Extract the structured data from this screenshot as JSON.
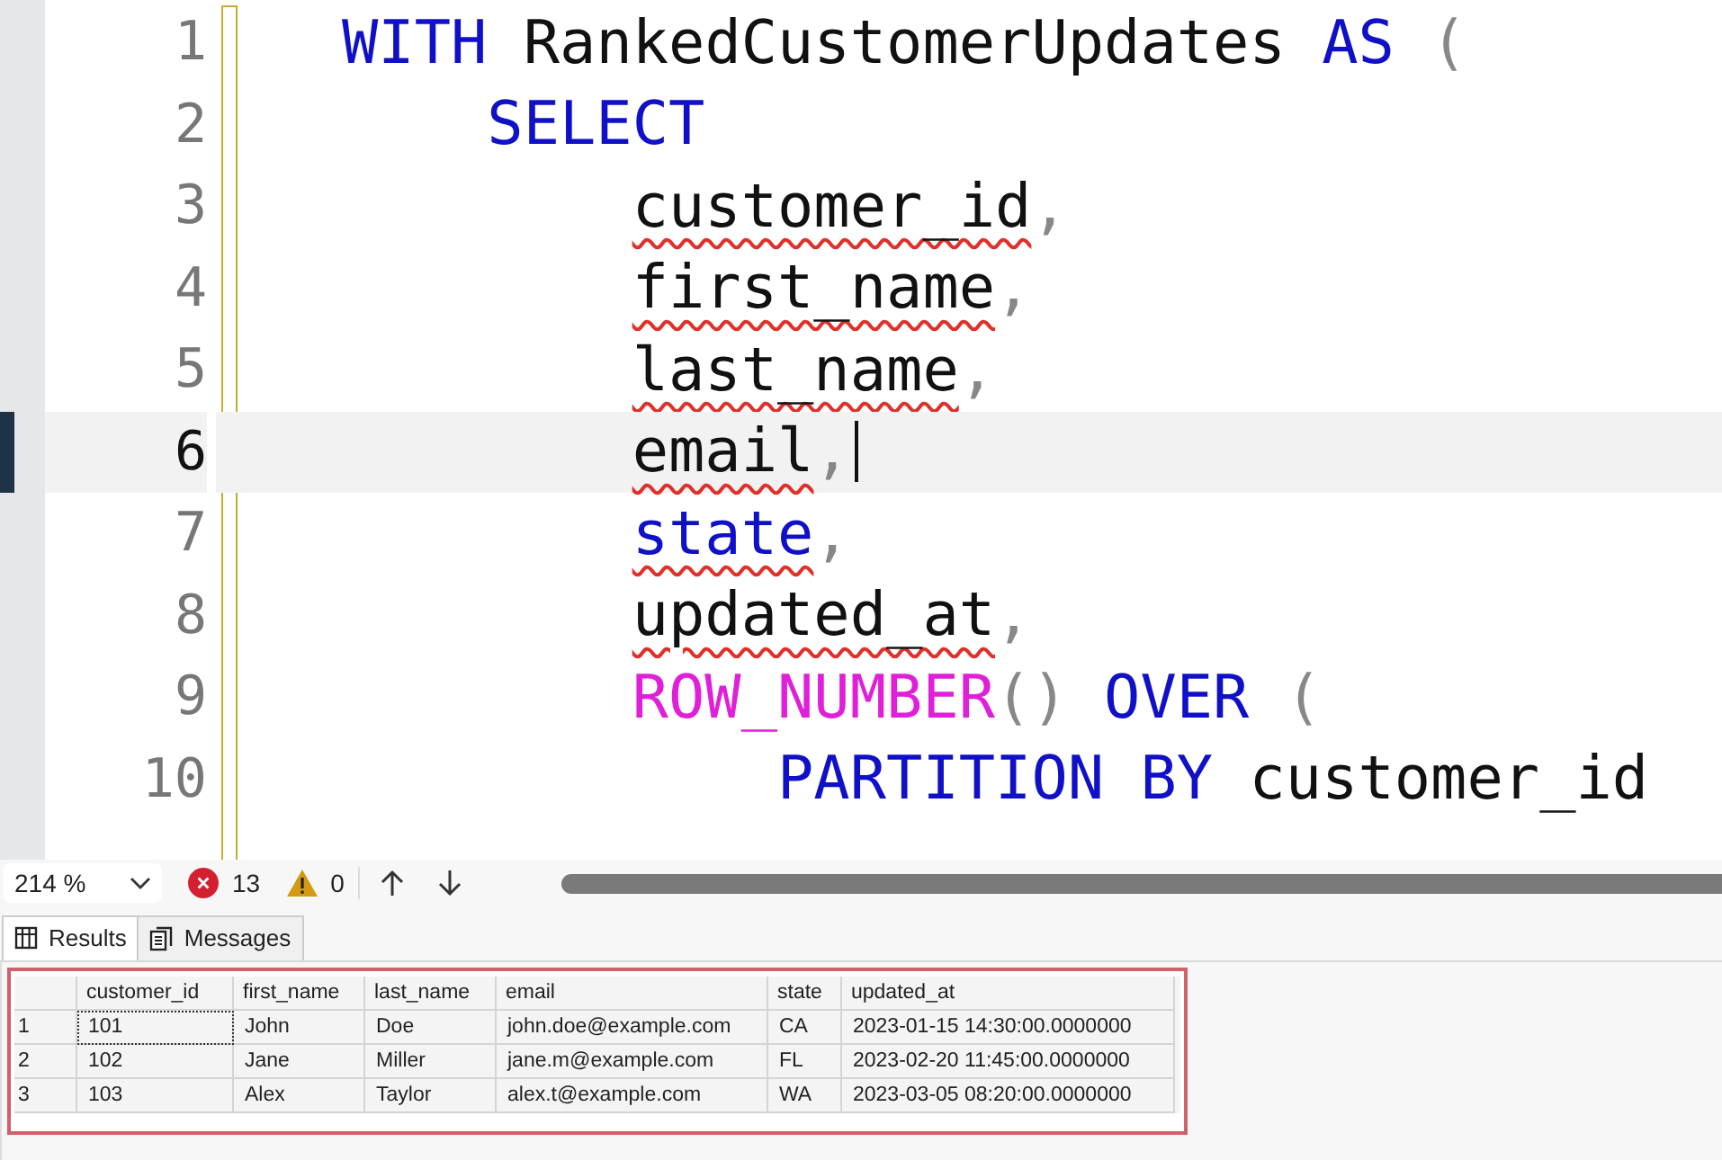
{
  "editor": {
    "lines": [
      {
        "number": "1",
        "current": false,
        "tokens": [
          {
            "text": "WITH",
            "kind": "keyword",
            "error": false
          },
          {
            "text": " RankedCustomerUpdates ",
            "kind": "ident",
            "error": false
          },
          {
            "text": "AS",
            "kind": "keyword",
            "error": false
          },
          {
            "text": " (",
            "kind": "punct",
            "error": false
          }
        ],
        "children": [
          {
            "number": "2",
            "current": false,
            "tokens": [
              {
                "text": "SELECT",
                "kind": "keyword",
                "error": false
              }
            ],
            "children": [
              {
                "number": "3",
                "current": false,
                "tokens": [
                  {
                    "text": "customer_id",
                    "kind": "ident",
                    "error": true
                  },
                  {
                    "text": ",",
                    "kind": "punct",
                    "error": false
                  }
                ]
              },
              {
                "number": "4",
                "current": false,
                "tokens": [
                  {
                    "text": "first_name",
                    "kind": "ident",
                    "error": true
                  },
                  {
                    "text": ",",
                    "kind": "punct",
                    "error": false
                  }
                ]
              },
              {
                "number": "5",
                "current": false,
                "tokens": [
                  {
                    "text": "last_name",
                    "kind": "ident",
                    "error": true
                  },
                  {
                    "text": ",",
                    "kind": "punct",
                    "error": false
                  }
                ]
              },
              {
                "number": "6",
                "current": true,
                "tokens": [
                  {
                    "text": "email",
                    "kind": "ident",
                    "error": true
                  },
                  {
                    "text": ",",
                    "kind": "punct",
                    "error": false
                  }
                ]
              },
              {
                "number": "7",
                "current": false,
                "tokens": [
                  {
                    "text": "state",
                    "kind": "keyword",
                    "error": true
                  },
                  {
                    "text": ",",
                    "kind": "punct",
                    "error": false
                  }
                ]
              },
              {
                "number": "8",
                "current": false,
                "tokens": [
                  {
                    "text": "updated_at",
                    "kind": "ident",
                    "error": true
                  },
                  {
                    "text": ",",
                    "kind": "punct",
                    "error": false
                  }
                ]
              },
              {
                "number": "9",
                "current": false,
                "tokens": [
                  {
                    "text": "ROW_NUMBER",
                    "kind": "function",
                    "error": false
                  },
                  {
                    "text": "() ",
                    "kind": "punct",
                    "error": false
                  },
                  {
                    "text": "OVER",
                    "kind": "keyword",
                    "error": false
                  },
                  {
                    "text": " (",
                    "kind": "punct",
                    "error": false
                  }
                ],
                "children": [
                  {
                    "number": "10",
                    "current": false,
                    "tokens": [
                      {
                        "text": "PARTITION BY",
                        "kind": "keyword",
                        "error": false
                      },
                      {
                        "text": " customer_id",
                        "kind": "ident",
                        "error": false
                      }
                    ]
                  }
                ]
              }
            ]
          }
        ]
      }
    ]
  },
  "toolbar": {
    "zoom": "214 %",
    "errors": "13",
    "warnings": "0"
  },
  "tabs": [
    {
      "label": "Results",
      "selected": true
    },
    {
      "label": "Messages",
      "selected": false
    }
  ],
  "results": {
    "columns": [
      "customer_id",
      "first_name",
      "last_name",
      "email",
      "state",
      "updated_at"
    ],
    "rows": [
      {
        "number": "1",
        "cells": [
          "101",
          "John",
          "Doe",
          "john.doe@example.com",
          "CA",
          "2023-01-15 14:30:00.0000000"
        ]
      },
      {
        "number": "2",
        "cells": [
          "102",
          "Jane",
          "Miller",
          "jane.m@example.com",
          "FL",
          "2023-02-20 11:45:00.0000000"
        ]
      },
      {
        "number": "3",
        "cells": [
          "103",
          "Alex",
          "Taylor",
          "alex.t@example.com",
          "WA",
          "2023-03-05 08:20:00.0000000"
        ]
      }
    ]
  }
}
